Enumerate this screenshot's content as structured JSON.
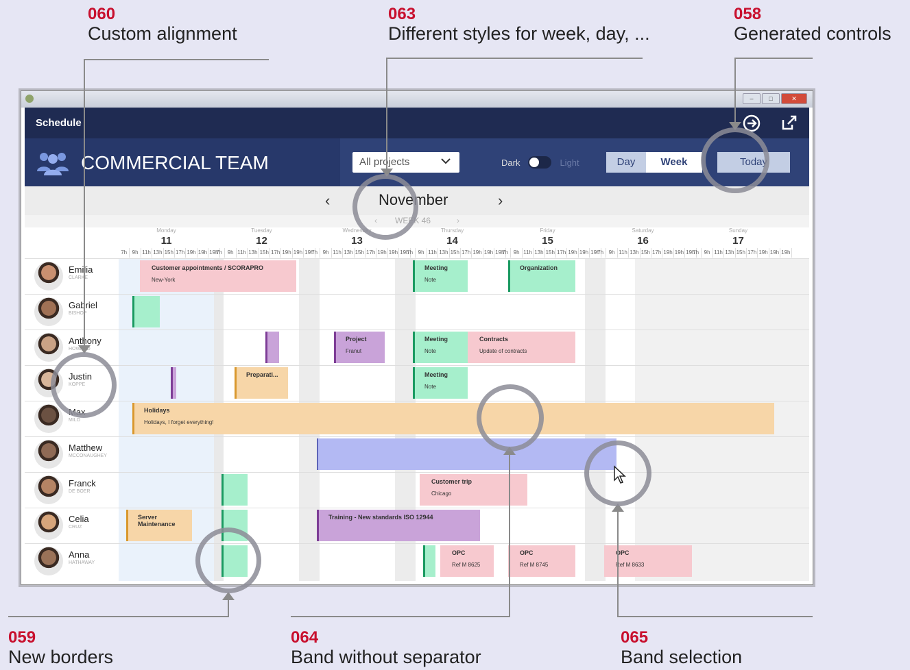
{
  "callouts": [
    {
      "num": "060",
      "label": "Custom  alignment"
    },
    {
      "num": "063",
      "label": "Different styles for week, day,  ..."
    },
    {
      "num": "058",
      "label": "Generated  controls"
    },
    {
      "num": "059",
      "label": "New borders"
    },
    {
      "num": "064",
      "label": "Band  without  separator"
    },
    {
      "num": "065",
      "label": "Band  selection"
    }
  ],
  "app": {
    "title": "Schedule",
    "team": "COMMERCIAL TEAM"
  },
  "toolbar": {
    "project_select": "All projects",
    "dark_label": "Dark",
    "light_label": "Light",
    "day_label": "Day",
    "week_label": "Week",
    "today_label": "Today"
  },
  "calendar": {
    "month": "November",
    "week": "WEEK 46",
    "days": [
      {
        "name": "Monday",
        "date": "11"
      },
      {
        "name": "Tuesday",
        "date": "12"
      },
      {
        "name": "Wednesday",
        "date": "13"
      },
      {
        "name": "Thursday",
        "date": "14"
      },
      {
        "name": "Friday",
        "date": "15"
      },
      {
        "name": "Saturday",
        "date": "16"
      },
      {
        "name": "Sunday",
        "date": "17"
      }
    ],
    "hours": [
      "7h",
      "9h",
      "11h",
      "13h",
      "15h",
      "17h",
      "19h"
    ]
  },
  "people": [
    {
      "name": "Emilia",
      "sub": "CLARKE"
    },
    {
      "name": "Gabriel",
      "sub": "BISHOP"
    },
    {
      "name": "Anthony",
      "sub": "HOWARD"
    },
    {
      "name": "Justin",
      "sub": "KOPPE"
    },
    {
      "name": "Max",
      "sub": "MILO"
    },
    {
      "name": "Matthew",
      "sub": "MCCONAUGHEY"
    },
    {
      "name": "Franck",
      "sub": "DE BOER"
    },
    {
      "name": "Celia",
      "sub": "CRUZ"
    },
    {
      "name": "Anna",
      "sub": "HATHAWAY"
    }
  ],
  "events": {
    "e1": {
      "title": "Customer appointments / SCORAPRO",
      "sub": "New-York"
    },
    "e2": {
      "title": "Meeting",
      "sub": "Note"
    },
    "e3": {
      "title": "Organization",
      "sub": ""
    },
    "e4": {
      "title": "Project",
      "sub": "Franut"
    },
    "e5": {
      "title": "Meeting",
      "sub": "Note"
    },
    "e6": {
      "title": "Contracts",
      "sub": "Update of contracts"
    },
    "e7": {
      "title": "Preparati...",
      "sub": ""
    },
    "e8": {
      "title": "Meeting",
      "sub": "Note"
    },
    "e9": {
      "title": "Holidays",
      "sub": "Holidays, I forget everything!"
    },
    "e10": {
      "title": "Customer trip",
      "sub": "Chicago"
    },
    "e11": {
      "title": "Server Maintenance",
      "sub": ""
    },
    "e12": {
      "title": "Training - New standards ISO 12944",
      "sub": ""
    },
    "e13": {
      "title": "OPC",
      "sub": "Ref M 8625"
    },
    "e14": {
      "title": "OPC",
      "sub": "Ref M 8745"
    },
    "e15": {
      "title": "OPC",
      "sub": "Ref M 8633"
    }
  },
  "colors": {
    "accent": "#c8102e",
    "navy": "#1f2b52",
    "band_blue": "#b3b9f3"
  }
}
